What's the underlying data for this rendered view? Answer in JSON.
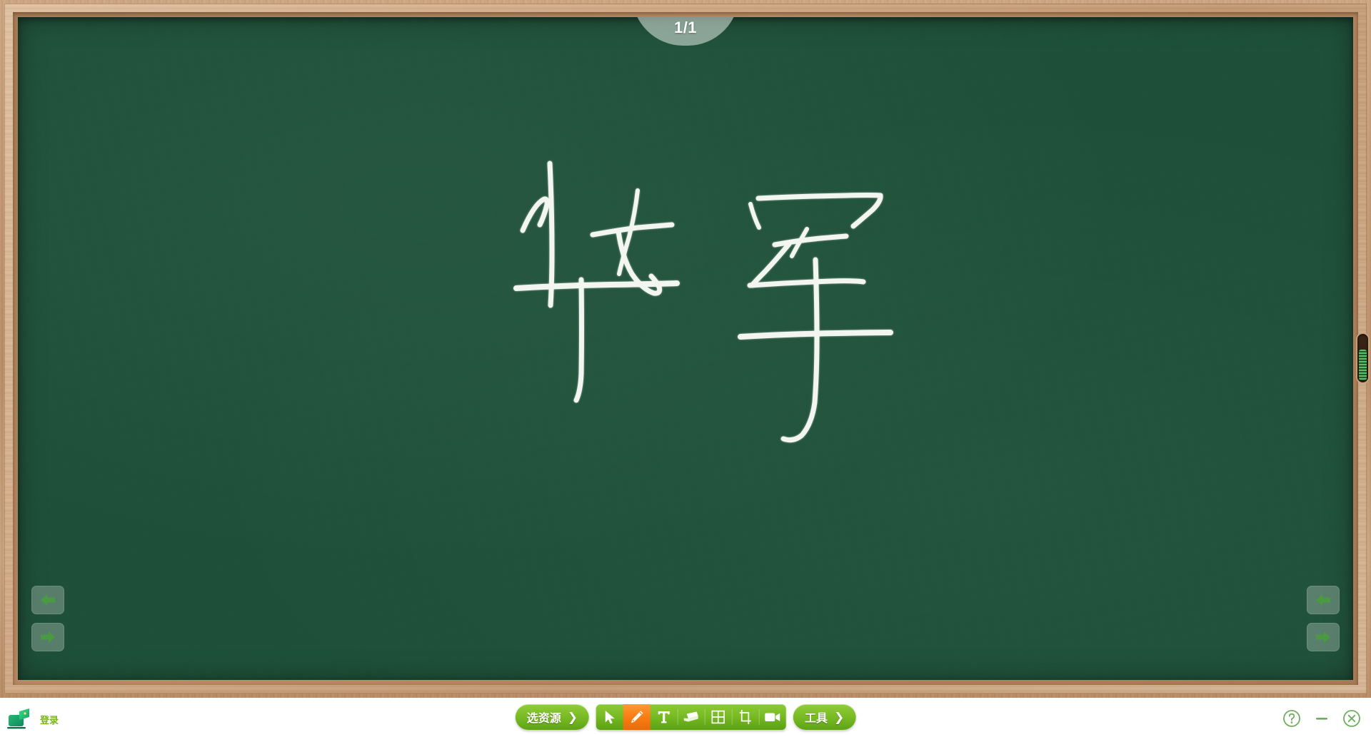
{
  "board": {
    "page_indicator": "1/1",
    "board_color": "#1d5038",
    "frame_color": "#c49a73",
    "chalk_color": "#f2f5f0",
    "handwriting_text": "华军"
  },
  "nav": {
    "left_prev_icon": "arrow-left-icon",
    "left_next_icon": "arrow-right-icon",
    "right_prev_icon": "arrow-left-icon",
    "right_next_icon": "arrow-right-icon",
    "arrow_color": "#4a9a3f"
  },
  "scrollbar": {
    "name": "vertical-slider",
    "rib_color": "#5bbf63"
  },
  "login": {
    "label": "登录",
    "icon": "laptop-screen-icon",
    "text_color": "#7ab41d"
  },
  "toolbar": {
    "resource_button": {
      "label": "选资源",
      "chevron": "❯"
    },
    "tools_button": {
      "label": "工具",
      "chevron": "❯"
    },
    "accent_green": "#78bb24",
    "active_orange": "#f97d15",
    "tools": [
      {
        "name": "cursor-tool",
        "icon": "cursor-arrow-icon",
        "active": false
      },
      {
        "name": "pen-tool",
        "icon": "pencil-icon",
        "active": true
      },
      {
        "name": "text-tool",
        "icon": "text-t-icon",
        "active": false
      },
      {
        "name": "eraser-tool",
        "icon": "eraser-icon",
        "active": false
      },
      {
        "name": "grid-tool",
        "icon": "grid-table-icon",
        "active": false
      },
      {
        "name": "crop-tool",
        "icon": "crop-icon",
        "active": false
      },
      {
        "name": "record-tool",
        "icon": "video-camera-icon",
        "active": false
      }
    ]
  },
  "window_controls": {
    "help": "?",
    "minimize": "—",
    "close": "×",
    "color": "#6fae5e"
  }
}
